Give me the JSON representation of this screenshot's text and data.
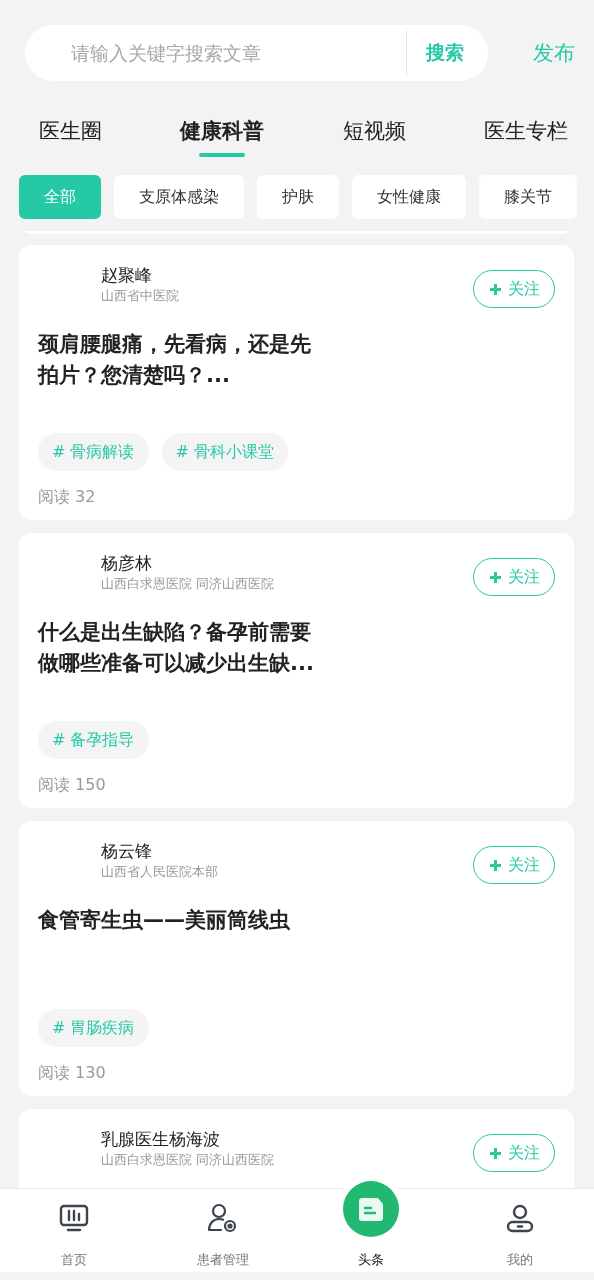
{
  "search": {
    "placeholder": "请输入关键字搜索文章",
    "button": "搜索"
  },
  "publish": "发布",
  "tabs": [
    {
      "label": "医生圈",
      "selected": false
    },
    {
      "label": "健康科普",
      "selected": true
    },
    {
      "label": "短视频",
      "selected": false
    },
    {
      "label": "医生专栏",
      "selected": false
    }
  ],
  "filters": [
    {
      "label": "全部",
      "selected": true
    },
    {
      "label": "支原体感染",
      "selected": false
    },
    {
      "label": "护肤",
      "selected": false
    },
    {
      "label": "女性健康",
      "selected": false
    },
    {
      "label": "膝关节",
      "selected": false
    }
  ],
  "articles": [
    {
      "author": "赵聚峰",
      "hospital": "山西省中医院",
      "follow": "关注",
      "title": "颈肩腰腿痛，先看病，还是先拍片？您清楚吗？...",
      "tags": [
        "# 骨病解读",
        "# 骨科小课堂"
      ],
      "reads": "阅读 32"
    },
    {
      "author": "杨彦林",
      "hospital": "山西白求恩医院 同济山西医院",
      "follow": "关注",
      "title": "什么是出生缺陷？备孕前需要做哪些准备可以减少出生缺...",
      "tags": [
        "# 备孕指导"
      ],
      "reads": "阅读 150"
    },
    {
      "author": "杨云锋",
      "hospital": "山西省人民医院本部",
      "follow": "关注",
      "title": "食管寄生虫——美丽筒线虫",
      "tags": [
        "# 胃肠疾病"
      ],
      "reads": "阅读 130"
    },
    {
      "author": "乳腺医生杨海波",
      "hospital": "山西白求恩医院 同济山西医院",
      "follow": "关注"
    }
  ],
  "nav": [
    {
      "label": "首页",
      "kind": "monitor",
      "selected": false
    },
    {
      "label": "患者管理",
      "kind": "patients",
      "selected": false
    },
    {
      "label": "头条",
      "kind": "news",
      "selected": true
    },
    {
      "label": "我的",
      "kind": "profile",
      "selected": false
    }
  ]
}
